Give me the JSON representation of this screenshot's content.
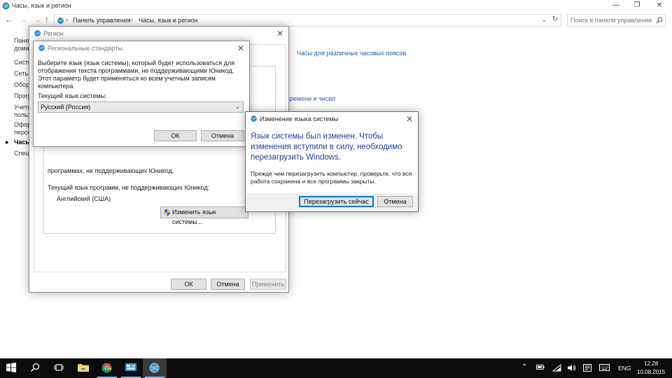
{
  "window": {
    "title": "Часы, язык и регион"
  },
  "address": {
    "crumb_root": "Панель управления",
    "crumb_current": "Часы, язык и регион",
    "search_placeholder": "Поиск в панели управления"
  },
  "left_nav": {
    "items": [
      "Панель",
      "домаш",
      "Систе",
      "Сеть и",
      "Обор",
      "Прогр",
      "Учетн",
      "польз",
      "Офор",
      "персо",
      "Часы",
      "Специ"
    ]
  },
  "main_links": {
    "time_zones": "Часы для различных часовых поясов",
    "time_numbers": "времени и чисел"
  },
  "region_dialog": {
    "title": "Регион",
    "programs_text": "программах, не поддерживающих Юникод.",
    "current_lang_label": "Текущий язык программ, не поддерживающих Юникод:",
    "current_lang_value": "Английский (США)",
    "change_button": "Изменить язык системы...",
    "ok": "ОК",
    "cancel": "Отмена",
    "apply": "Применить"
  },
  "regional_dialog": {
    "title": "Региональные стандарты",
    "description": "Выберите язык (язык системы), который будет использоваться для отображения текста программами, не поддерживающими Юникод. Этот параметр будет применяться ко всем учетным записям компьютера.",
    "current_label": "Текущий язык системы:",
    "selected": "Русский (Россия)",
    "ok": "ОК",
    "cancel": "Отмена"
  },
  "restart_dialog": {
    "title": "Изменение языка системы",
    "heading": "Язык системы был изменен. Чтобы изменения вступили в силу, необходимо перезагрузить Windows.",
    "body": "Прежде чем перезагрузить компьютер, проверьте, что вся работа сохранена и все программы закрыты.",
    "restart": "Перезагрузить сейчас",
    "cancel": "Отмена"
  },
  "taskbar": {
    "language": "ENG",
    "time": "12:28",
    "date": "10.08.2015"
  },
  "colors": {
    "accent": "#0078d7",
    "link": "#1e5eb0",
    "heading": "#1e3e9e",
    "taskbar": "#0b0b0b"
  },
  "icons": [
    "globe-icon",
    "back-arrow-icon",
    "forward-arrow-icon",
    "up-arrow-icon",
    "search-icon",
    "refresh-icon",
    "shield-icon",
    "windows-logo-icon",
    "cortana-search-icon",
    "task-view-icon",
    "file-explorer-icon",
    "chrome-icon",
    "control-panel-icon",
    "region-icon",
    "battery-icon",
    "wifi-icon",
    "volume-icon",
    "notification-icon",
    "keyboard-icon"
  ]
}
